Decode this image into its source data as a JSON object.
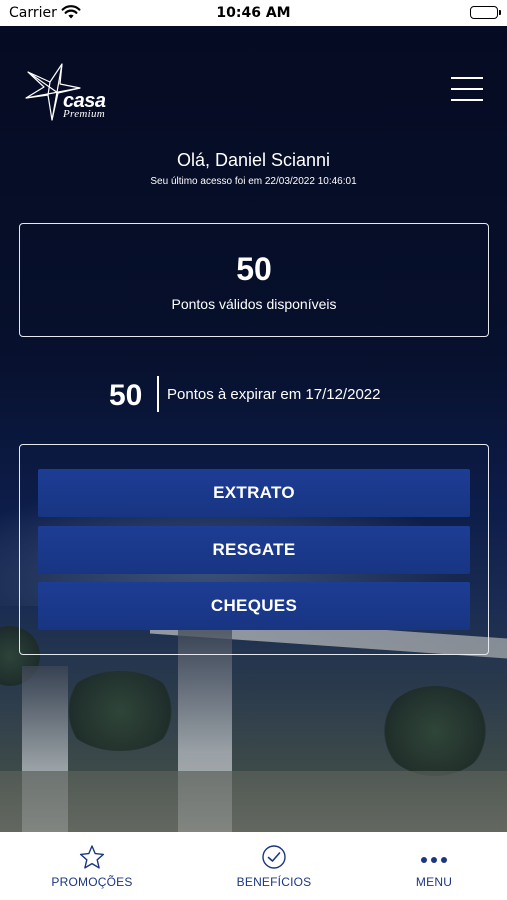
{
  "status_bar": {
    "carrier": "Carrier",
    "time": "10:46 AM"
  },
  "header": {
    "brand_name": "casa",
    "brand_sub": "Premium",
    "menu_icon": "hamburger-icon"
  },
  "user": {
    "greeting": "Olá, Daniel Scianni",
    "last_access": "Seu último acesso foi em 22/03/2022 10:46:01"
  },
  "points": {
    "valid_value": "50",
    "valid_label": "Pontos válidos disponíveis",
    "expiring_value": "50",
    "expiring_label": "Pontos à expirar em 17/12/2022"
  },
  "actions": [
    {
      "label": "EXTRATO"
    },
    {
      "label": "RESGATE"
    },
    {
      "label": "CHEQUES"
    }
  ],
  "tabbar": [
    {
      "label": "PROMOÇÕES",
      "icon": "star-icon"
    },
    {
      "label": "BENEFÍCIOS",
      "icon": "check-circle-icon"
    },
    {
      "label": "MENU",
      "icon": "more-dots-icon"
    }
  ],
  "colors": {
    "background_top": "#050b22",
    "button_blue": "#1d3d95",
    "tab_text": "#1c3781",
    "white": "#ffffff"
  }
}
